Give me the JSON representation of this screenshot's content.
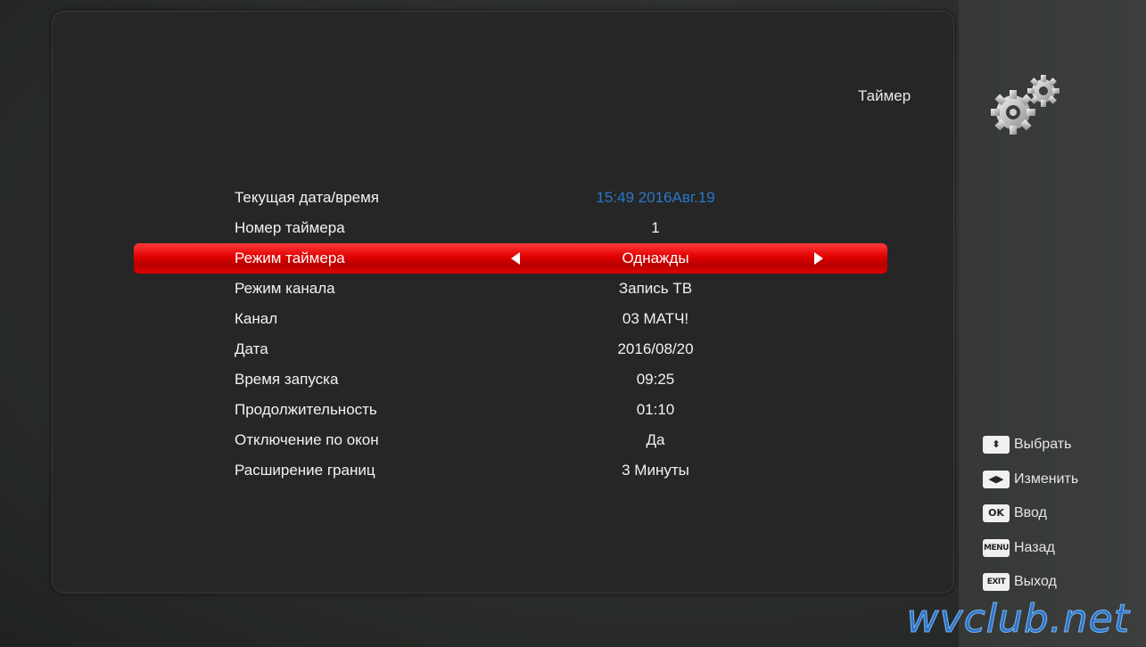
{
  "header": {
    "title": "Таймер",
    "icon": "gears-icon"
  },
  "menu": {
    "rows": [
      {
        "label": "Текущая дата/время",
        "value": "15:49 2016Авг.19"
      },
      {
        "label": "Номер таймера",
        "value": "1"
      },
      {
        "label": "Режим таймера",
        "value": "Однажды"
      },
      {
        "label": "Режим канала",
        "value": "Запись ТВ"
      },
      {
        "label": "Канал",
        "value": "03 МАТЧ!"
      },
      {
        "label": "Дата",
        "value": "2016/08/20"
      },
      {
        "label": "Время запуска",
        "value": "09:25"
      },
      {
        "label": "Продолжительность",
        "value": "01:10"
      },
      {
        "label": "Отключение по окон",
        "value": "Да"
      },
      {
        "label": "Расширение границ",
        "value": "3 Минуты"
      }
    ]
  },
  "help": [
    {
      "key": "⬍",
      "label": "Выбрать"
    },
    {
      "key": "◀▶",
      "label": "Изменить"
    },
    {
      "key": "OK",
      "label": "Ввод"
    },
    {
      "key": "MENU",
      "label": "Назад"
    },
    {
      "key": "EXIT",
      "label": "Выход"
    }
  ],
  "watermark": "wvclub.net",
  "colors": {
    "highlight": "#e00000",
    "datetime": "#2a77c9",
    "panel": "#262626"
  }
}
